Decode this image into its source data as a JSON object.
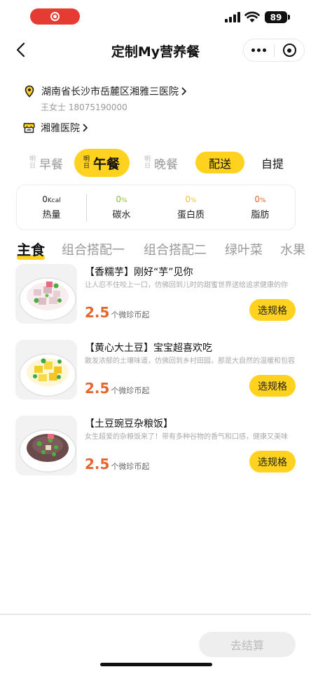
{
  "status_bar": {
    "battery": "89"
  },
  "nav": {
    "title": "定制My营养餐"
  },
  "address": {
    "line": "湖南省长沙市岳麓区湘雅三医院",
    "contact": "王女士 18075190000",
    "hospital": "湘雅医院"
  },
  "meals": {
    "tomorrow_tag": "明日",
    "items": [
      {
        "label": "早餐",
        "active": false
      },
      {
        "label": "午餐",
        "active": true
      },
      {
        "label": "晚餐",
        "active": false
      }
    ],
    "delivery_label": "配送",
    "pickup_label": "自提"
  },
  "nutrition": [
    {
      "value": "0",
      "unit": "Kcal",
      "label": "热量",
      "color": "#222222"
    },
    {
      "value": "0",
      "unit": "%",
      "label": "碳水",
      "color": "#8bbf3d"
    },
    {
      "value": "0",
      "unit": "%",
      "label": "蛋白质",
      "color": "#f0c23a"
    },
    {
      "value": "0",
      "unit": "%",
      "label": "脂肪",
      "color": "#e5672e"
    }
  ],
  "tabs": [
    "主食",
    "组合搭配一",
    "组合搭配二",
    "绿叶菜",
    "水果"
  ],
  "products": [
    {
      "name": "【香糯芋】刚好“芋”见你",
      "desc": "让人忍不住咬上一口，仿佛回到儿时的甜蜜世界送给追求健康的你",
      "price": "2.5",
      "unit": "个微珍币起",
      "button": "选规格"
    },
    {
      "name": "【黄心大土豆】宝宝超喜欢吃",
      "desc": "散发浓郁的土壤味道，仿佛回到乡村田园，那是大自然的温暖和包容",
      "price": "2.5",
      "unit": "个微珍币起",
      "button": "选规格"
    },
    {
      "name": "【土豆豌豆杂粮饭】",
      "desc": "女生超爱的杂粮饭来了！带有多种谷物的香气和口感，健康又美味",
      "price": "2.5",
      "unit": "个微珍币起",
      "button": "选规格"
    }
  ],
  "footer": {
    "checkout_label": "去结算"
  },
  "colors": {
    "accent": "#ffd21f",
    "price": "#e5672e",
    "record": "#e63b32"
  }
}
